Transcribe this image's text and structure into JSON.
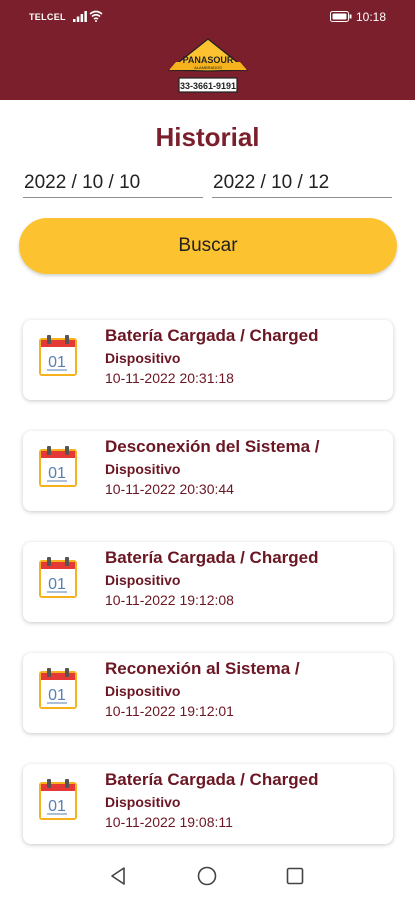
{
  "status_bar": {
    "carrier": "TELCEL",
    "time": "10:18",
    "icons": [
      "signal-icon",
      "wifi-icon",
      "battery-icon"
    ]
  },
  "logo": {
    "brand": "PANASOUR",
    "tagline": "ALAMBRADOS",
    "phone": "33-3661-9191"
  },
  "page": {
    "title": "Historial"
  },
  "filters": {
    "start_date": "2022 / 10 / 10",
    "end_date": "2022 / 10 / 12",
    "search_label": "Buscar"
  },
  "events": [
    {
      "title": "Batería Cargada / Charged",
      "source": "Dispositivo",
      "timestamp": "10-11-2022 20:31:18",
      "icon": "calendar-icon",
      "day": "01"
    },
    {
      "title": "Desconexión del Sistema /",
      "source": "Dispositivo",
      "timestamp": "10-11-2022 20:30:44",
      "icon": "calendar-icon",
      "day": "01"
    },
    {
      "title": "Batería Cargada / Charged",
      "source": "Dispositivo",
      "timestamp": "10-11-2022 19:12:08",
      "icon": "calendar-icon",
      "day": "01"
    },
    {
      "title": "Reconexión al Sistema /",
      "source": "Dispositivo",
      "timestamp": "10-11-2022 19:12:01",
      "icon": "calendar-icon",
      "day": "01"
    },
    {
      "title": "Batería Cargada / Charged",
      "source": "Dispositivo",
      "timestamp": "10-11-2022 19:08:11",
      "icon": "calendar-icon",
      "day": "01"
    }
  ],
  "nav": {
    "icons": [
      "back-icon",
      "home-icon",
      "recents-icon"
    ]
  },
  "colors": {
    "header": "#7a1f2b",
    "accent": "#fcc22f",
    "text_dark_red": "#6b1623"
  }
}
